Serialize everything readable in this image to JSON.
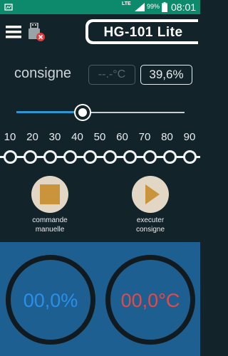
{
  "status_bar": {
    "network_type": "LTE",
    "battery_percent": "99%",
    "time": "08:01",
    "colors": {
      "background": "#0d8a6b"
    },
    "icons": [
      "notification-icon",
      "signal-icon",
      "battery-icon"
    ]
  },
  "app_bar": {
    "title": "HG-101 Lite",
    "icons": [
      "menu-icon",
      "usb-disconnected-icon"
    ]
  },
  "consigne": {
    "label": "consigne",
    "temperature": "--.-°C",
    "percent": "39,6%"
  },
  "slider": {
    "value_percent": 39.6,
    "colors": {
      "fill": "#2f95d0",
      "track": "#c7cdd0"
    }
  },
  "scale": {
    "ticks": [
      "10",
      "20",
      "30",
      "40",
      "50",
      "60",
      "70",
      "80",
      "90"
    ]
  },
  "actions": {
    "manual": {
      "line1": "commande",
      "line2": "manuelle",
      "icon": "stop-square-icon"
    },
    "execute": {
      "line1": "executer",
      "line2": "consigne",
      "icon": "play-icon"
    }
  },
  "gauges": {
    "power": "00,0%",
    "temperature": "00,0°C",
    "colors": {
      "panel": "#1e5f92",
      "power": "#2a8fe8",
      "temperature": "#e24a4a"
    }
  }
}
